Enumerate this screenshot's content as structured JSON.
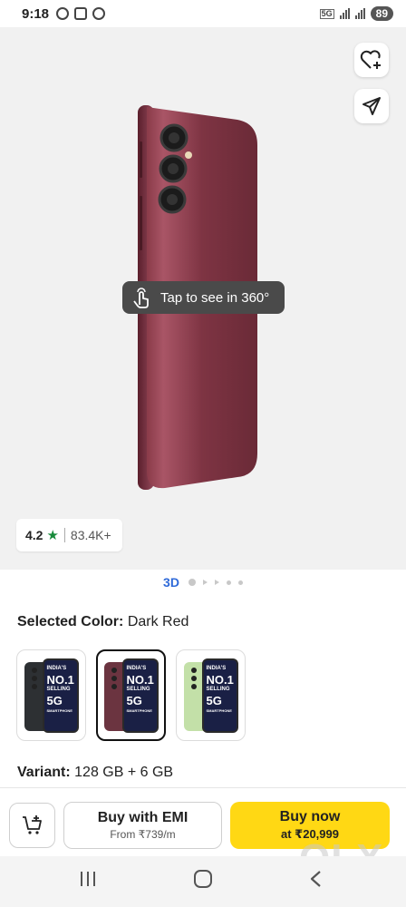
{
  "status_bar": {
    "time": "9:18",
    "network_label": "5G",
    "battery": "89",
    "icons": [
      "whatsapp-icon",
      "screenshot-icon",
      "messenger-icon",
      "signal-icon",
      "battery-icon"
    ]
  },
  "hero": {
    "tap_label": "Tap to see in 360°",
    "rating": "4.2",
    "rating_star": "★",
    "rating_count": "83.4K+",
    "actions": [
      "wishlist-heart-icon",
      "share-icon"
    ],
    "phone_color": "#7a2e3a"
  },
  "pager": {
    "label": "3D"
  },
  "product": {
    "selected_color_label": "Selected Color:",
    "selected_color_value": "Dark Red",
    "variant_label": "Variant:",
    "variant_value": "128 GB + 6 GB",
    "swatches": [
      {
        "name": "Black",
        "back_color": "#2d3033",
        "text1": "INDIA'S",
        "big": "NO.1",
        "text2": "SELLING",
        "big2": "5G",
        "text3": "SMARTPHONE"
      },
      {
        "name": "Dark Red",
        "back_color": "#6b3440",
        "text1": "INDIA'S",
        "big": "NO.1",
        "text2": "SELLING",
        "big2": "5G",
        "text3": "SMARTPHONE"
      },
      {
        "name": "Light Green",
        "back_color": "#c3e0a8",
        "text1": "INDIA'S",
        "big": "NO.1",
        "text2": "SELLING",
        "big2": "5G",
        "text3": "SMARTPHONE"
      }
    ]
  },
  "actions": {
    "emi_title": "Buy with EMI",
    "emi_sub": "From ₹739/m",
    "buy_title": "Buy now",
    "buy_sub": "at ₹20,999"
  },
  "watermark": "OLX",
  "colors": {
    "accent_blue": "#2f6ad9",
    "buy_yellow": "#ffd814",
    "star_green": "#168a3a"
  }
}
